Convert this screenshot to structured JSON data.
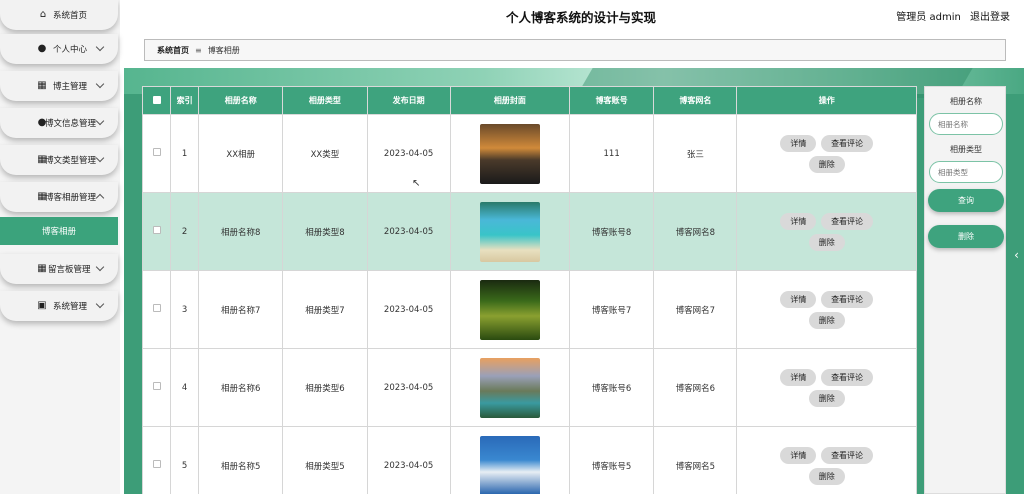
{
  "sidebar": {
    "items": [
      {
        "label": "系统首页",
        "icon": "home-icon"
      },
      {
        "label": "个人中心",
        "icon": "user-icon"
      },
      {
        "label": "博主管理",
        "icon": "calendar-icon"
      },
      {
        "label": "博文信息管理",
        "icon": "user-edit-icon"
      },
      {
        "label": "博文类型管理",
        "icon": "grid-icon"
      },
      {
        "label": "博客相册管理",
        "icon": "grid-icon"
      },
      {
        "label": "留言板管理",
        "icon": "table-icon"
      },
      {
        "label": "系统管理",
        "icon": "briefcase-icon"
      }
    ],
    "active_sub": "博客相册"
  },
  "header": {
    "title": "个人博客系统的设计与实现",
    "user": "管理员 admin",
    "logout": "退出登录"
  },
  "breadcrumb": {
    "home": "系统首页",
    "current": "博客相册"
  },
  "table": {
    "headers": [
      "索引",
      "相册名称",
      "相册类型",
      "发布日期",
      "相册封面",
      "博客账号",
      "博客网名",
      "操作"
    ],
    "rows": [
      {
        "index": "1",
        "name": "XX相册",
        "type": "XX类型",
        "date": "2023-04-05",
        "account": "111",
        "nickname": "张三"
      },
      {
        "index": "2",
        "name": "相册名称8",
        "type": "相册类型8",
        "date": "2023-04-05",
        "account": "博客账号8",
        "nickname": "博客网名8"
      },
      {
        "index": "3",
        "name": "相册名称7",
        "type": "相册类型7",
        "date": "2023-04-05",
        "account": "博客账号7",
        "nickname": "博客网名7"
      },
      {
        "index": "4",
        "name": "相册名称6",
        "type": "相册类型6",
        "date": "2023-04-05",
        "account": "博客账号6",
        "nickname": "博客网名6"
      },
      {
        "index": "5",
        "name": "相册名称5",
        "type": "相册类型5",
        "date": "2023-04-05",
        "account": "博客账号5",
        "nickname": "博客网名5"
      }
    ],
    "actions": {
      "detail": "详情",
      "comments": "查看评论",
      "delete": "删除"
    }
  },
  "search": {
    "name_label": "相册名称",
    "name_placeholder": "相册名称",
    "type_label": "相册类型",
    "type_placeholder": "相册类型",
    "query_button": "查询",
    "delete_button": "删除"
  },
  "colors": {
    "accent": "#3ea37e",
    "highlight_row": "#c5e6d9"
  }
}
